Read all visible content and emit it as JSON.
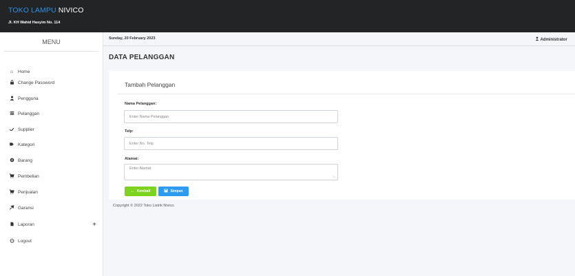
{
  "header": {
    "brand_part1": "TOKO LAMPU ",
    "brand_part2": "NIVICO",
    "address": "Jl. KH Wahid Hasyim No. 114"
  },
  "sidebar": {
    "title": "MENU",
    "items": [
      {
        "label": "Home",
        "icon": "home-icon"
      },
      {
        "label": "Change Password",
        "icon": "lock-icon"
      },
      {
        "label": "Pengguna",
        "icon": "user-icon"
      },
      {
        "label": "Pelanggan",
        "icon": "list-icon"
      },
      {
        "label": "Supplier",
        "icon": "wrench-icon"
      },
      {
        "label": "Kategori",
        "icon": "tag-icon"
      },
      {
        "label": "Barang",
        "icon": "box-icon"
      },
      {
        "label": "Pembelian",
        "icon": "cart-icon"
      },
      {
        "label": "Penjualan",
        "icon": "cart-icon"
      },
      {
        "label": "Garansi",
        "icon": "shield-icon"
      },
      {
        "label": "Laporan",
        "icon": "file-icon"
      },
      {
        "label": "Logout",
        "icon": "power-icon"
      }
    ],
    "laporan_expand": "+"
  },
  "topinfo": {
    "date": "Sunday, 20 February 2023",
    "user": "Administrator"
  },
  "page": {
    "title": "DATA PELANGGAN"
  },
  "form": {
    "title": "Tambah Pelanggan",
    "name_label": "Nama Pelanggan:",
    "name_placeholder": "Enter Nama Pelanggan",
    "telp_label": "Telp:",
    "telp_placeholder": "Enter No. Telp",
    "alamat_label": "Alamat:",
    "alamat_placeholder": "Enter Alamat",
    "back_label": "Kembali",
    "save_label": "Simpan"
  },
  "footer": {
    "text": "Copyright © 2022 Toko Listrik Nivico."
  },
  "colors": {
    "topbar": "#222426",
    "brand_blue": "#2f8fe6",
    "back_green": "#7ed321",
    "save_blue": "#2d9cf0"
  }
}
